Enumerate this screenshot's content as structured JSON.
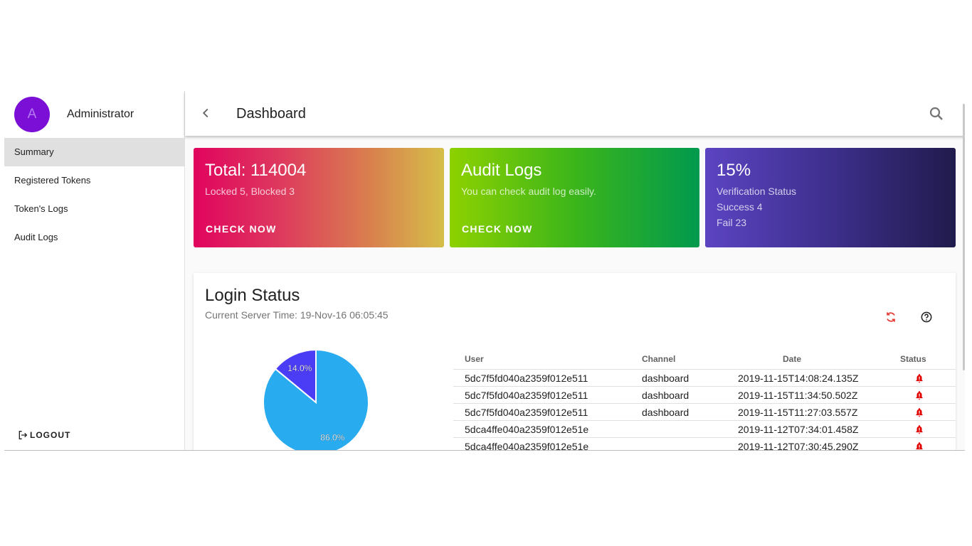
{
  "sidebar": {
    "avatar_letter": "A",
    "user_name": "Administrator",
    "items": [
      {
        "label": "Summary",
        "active": true
      },
      {
        "label": "Registered Tokens"
      },
      {
        "label": "Token's Logs"
      },
      {
        "label": "Audit Logs"
      }
    ],
    "logout_label": "LOGOUT"
  },
  "header": {
    "title": "Dashboard",
    "back_icon": "chevron-left-icon",
    "search_icon": "search-icon"
  },
  "cards": [
    {
      "title": "Total: 114004",
      "subtitle": "Locked 5, Blocked 3",
      "action": "CHECK NOW"
    },
    {
      "title": "Audit Logs",
      "subtitle": "You can check audit log easily.",
      "action": "CHECK NOW"
    },
    {
      "title": "15%",
      "lines": [
        "Verification Status",
        "Success 4",
        "Fail 23"
      ]
    }
  ],
  "login_status": {
    "title": "Login Status",
    "server_time": "Current Server Time: 19-Nov-16 06:05:45",
    "columns": [
      "User",
      "Channel",
      "Date",
      "Status"
    ],
    "rows": [
      {
        "user": "5dc7f5fd040a2359f012e511",
        "channel": "dashboard",
        "date": "2019-11-15T14:08:24.135Z"
      },
      {
        "user": "5dc7f5fd040a2359f012e511",
        "channel": "dashboard",
        "date": "2019-11-15T11:34:50.502Z"
      },
      {
        "user": "5dc7f5fd040a2359f012e511",
        "channel": "dashboard",
        "date": "2019-11-15T11:27:03.557Z"
      },
      {
        "user": "5dca4ffe040a2359f012e51e",
        "channel": "",
        "date": "2019-11-12T07:34:01.458Z"
      },
      {
        "user": "5dca4ffe040a2359f012e51e",
        "channel": "",
        "date": "2019-11-12T07:30:45.290Z"
      }
    ]
  },
  "colors": {
    "accent": "#7b0fd6",
    "pie_major": "#29abef",
    "pie_minor": "#4b3df5",
    "status_alert": "#e00000",
    "refresh": "#e53935"
  },
  "chart_data": {
    "type": "pie",
    "slices": [
      {
        "label": "86.0%",
        "value": 86.0,
        "color": "#29abef"
      },
      {
        "label": "14.0%",
        "value": 14.0,
        "color": "#4b3df5"
      }
    ]
  }
}
